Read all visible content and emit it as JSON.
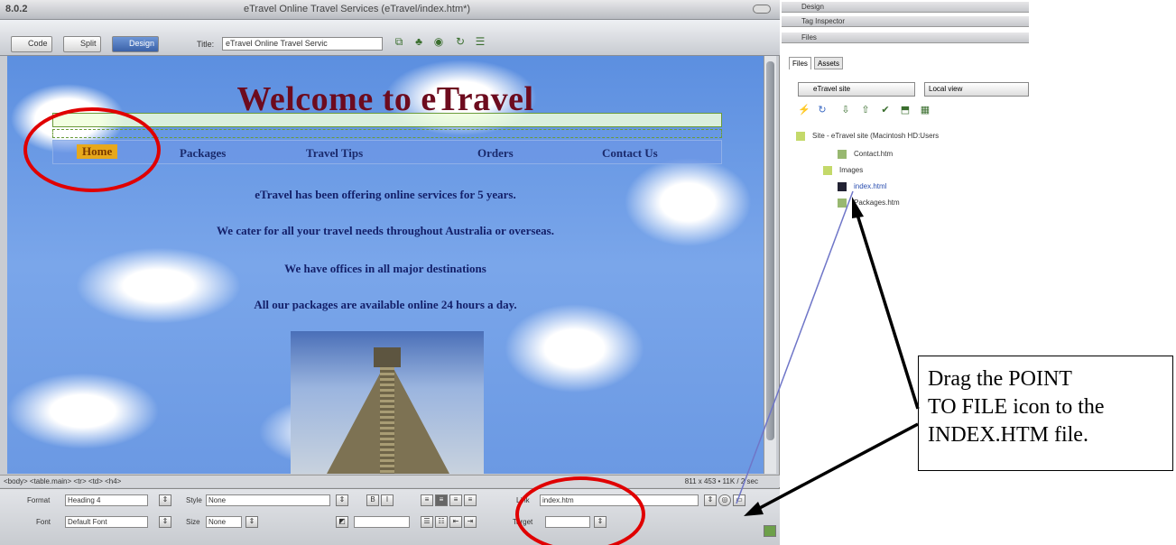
{
  "window": {
    "version": "8.0.2",
    "title": "eTravel Online Travel Services (eTravel/index.htm*)"
  },
  "toolbar": {
    "code_label": "Code",
    "split_label": "Split",
    "design_label": "Design",
    "title_label": "Title:",
    "title_value": "eTravel Online Travel Servic"
  },
  "page": {
    "heading": "Welcome to eTravel",
    "nav": [
      "Home",
      "Packages",
      "Travel Tips",
      "Orders",
      "Contact Us"
    ],
    "lines": [
      "eTravel has been offering online services for 5 years.",
      "We cater for all your travel needs throughout Australia or overseas.",
      "We have offices in all major destinations",
      "All our packages are available online 24 hours a day."
    ]
  },
  "statusbar": {
    "tags": "<body> <table.main> <tr> <td> <h4>",
    "info": "811 x 453 • 11K / 2 sec"
  },
  "properties": {
    "format_label": "Format",
    "format_value": "Heading 4",
    "style_label": "Style",
    "style_value": "None",
    "font_label": "Font",
    "font_value": "Default Font",
    "size_label": "Size",
    "size_value": "None",
    "link_label": "Link",
    "link_value": "index.htm",
    "target_label": "Target"
  },
  "panels": {
    "design": "Design",
    "tag_inspector": "Tag Inspector",
    "files": "Files",
    "tab_files": "Files",
    "tab_assets": "Assets",
    "site_select": "eTravel site",
    "view_select": "Local view",
    "tree": [
      "Site - eTravel site (Macintosh HD:Users",
      "Contact.htm",
      "Images",
      "index.html",
      "Packages.htm"
    ]
  },
  "callout": {
    "lines": [
      "Drag the POINT",
      "TO FILE icon to the",
      "INDEX.HTM file."
    ]
  },
  "colors": {
    "heading": "#6d0b1e",
    "annotation_red": "#e00000",
    "nav_text": "#1a2a6c",
    "home_highlight": "#e7a81b"
  }
}
